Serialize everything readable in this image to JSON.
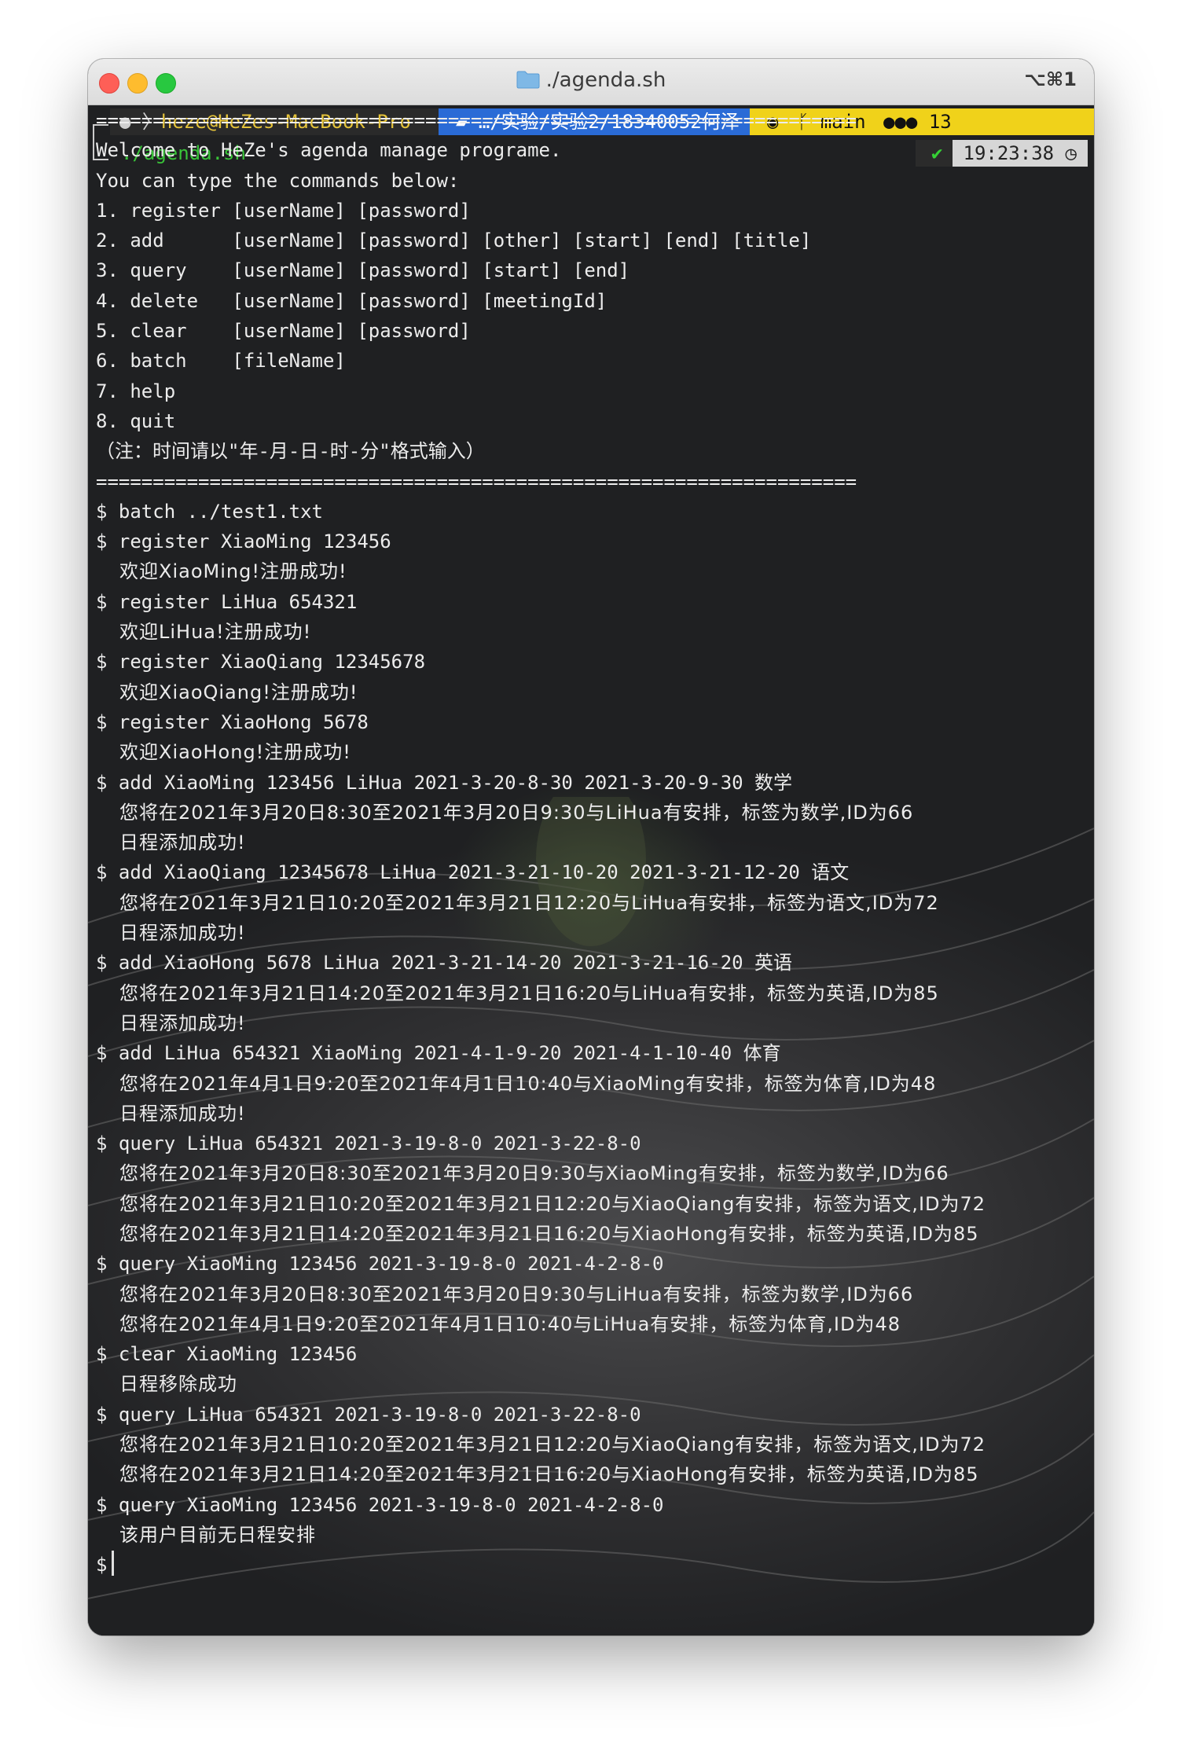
{
  "window": {
    "title": "./agenda.sh",
    "shortcut": "⌥⌘1"
  },
  "prompt": {
    "apple_icon": "apple-icon",
    "host": "heze@HeZes-MacBook-Pro",
    "path": "…/实验/实验2/18340052何泽",
    "git_branch": "main",
    "git_count": "13",
    "command": "./agenda.sh",
    "status_time": "19:23:38"
  },
  "lines": [
    "===================================================================",
    "Welcome to HeZe's agenda manage programe.",
    "You can type the commands below:",
    "1. register [userName] [password]",
    "2. add      [userName] [password] [other] [start] [end] [title]",
    "3. query    [userName] [password] [start] [end]",
    "4. delete   [userName] [password] [meetingId]",
    "5. clear    [userName] [password]",
    "6. batch    [fileName]",
    "7. help",
    "8. quit",
    "（注：时间请以\"年-月-日-时-分\"格式输入）",
    "===================================================================",
    "$ batch ../test1.txt",
    "$ register XiaoMing 123456",
    "欢迎XiaoMing!注册成功!",
    "$ register LiHua 654321",
    "欢迎LiHua!注册成功!",
    "$ register XiaoQiang 12345678",
    "欢迎XiaoQiang!注册成功!",
    "$ register XiaoHong 5678",
    "欢迎XiaoHong!注册成功!",
    "$ add XiaoMing 123456 LiHua 2021-3-20-8-30 2021-3-20-9-30 数学",
    "您将在2021年3月20日8:30至2021年3月20日9:30与LiHua有安排，标签为数学,ID为66",
    "日程添加成功!",
    "$ add XiaoQiang 12345678 LiHua 2021-3-21-10-20 2021-3-21-12-20 语文",
    "您将在2021年3月21日10:20至2021年3月21日12:20与LiHua有安排，标签为语文,ID为72",
    "日程添加成功!",
    "$ add XiaoHong 5678 LiHua 2021-3-21-14-20 2021-3-21-16-20 英语",
    "您将在2021年3月21日14:20至2021年3月21日16:20与LiHua有安排，标签为英语,ID为85",
    "日程添加成功!",
    "$ add LiHua 654321 XiaoMing 2021-4-1-9-20 2021-4-1-10-40 体育",
    "您将在2021年4月1日9:20至2021年4月1日10:40与XiaoMing有安排，标签为体育,ID为48",
    "日程添加成功!",
    "$ query LiHua 654321 2021-3-19-8-0 2021-3-22-8-0",
    "您将在2021年3月20日8:30至2021年3月20日9:30与XiaoMing有安排，标签为数学,ID为66",
    "您将在2021年3月21日10:20至2021年3月21日12:20与XiaoQiang有安排，标签为语文,ID为72",
    "您将在2021年3月21日14:20至2021年3月21日16:20与XiaoHong有安排，标签为英语,ID为85",
    "$ query XiaoMing 123456 2021-3-19-8-0 2021-4-2-8-0",
    "您将在2021年3月20日8:30至2021年3月20日9:30与LiHua有安排，标签为数学,ID为66",
    "您将在2021年4月1日9:20至2021年4月1日10:40与LiHua有安排，标签为体育,ID为48",
    "$ clear XiaoMing 123456",
    "日程移除成功",
    "$ query LiHua 654321 2021-3-19-8-0 2021-3-22-8-0",
    "您将在2021年3月21日10:20至2021年3月21日12:20与XiaoQiang有安排，标签为语文,ID为72",
    "您将在2021年3月21日14:20至2021年3月21日16:20与XiaoHong有安排，标签为英语,ID为85",
    "$ query XiaoMing 123456 2021-3-19-8-0 2021-4-2-8-0",
    "该用户目前无日程安排"
  ],
  "indented_lines": [
    15,
    17,
    19,
    21,
    23,
    24,
    26,
    27,
    29,
    30,
    32,
    33,
    35,
    36,
    37,
    39,
    40,
    42,
    44,
    45,
    47
  ],
  "current_prompt": "$"
}
